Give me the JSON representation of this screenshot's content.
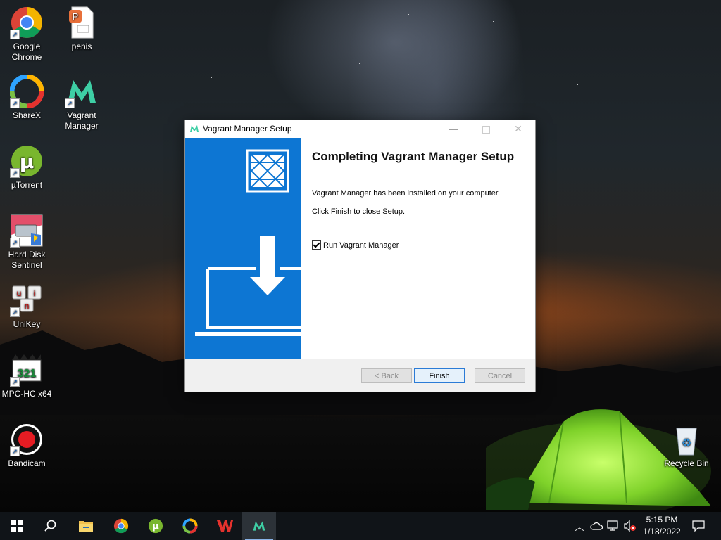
{
  "desktop_icons": [
    {
      "id": "chrome",
      "label_1": "Google",
      "label_2": "Chrome"
    },
    {
      "id": "penis",
      "label_1": "penis",
      "label_2": ""
    },
    {
      "id": "sharex",
      "label_1": "ShareX",
      "label_2": ""
    },
    {
      "id": "vagrant",
      "label_1": "Vagrant",
      "label_2": "Manager"
    },
    {
      "id": "utorrent",
      "label_1": "µTorrent",
      "label_2": ""
    },
    {
      "id": "hds",
      "label_1": "Hard Disk",
      "label_2": "Sentinel"
    },
    {
      "id": "unikey",
      "label_1": "UniKey",
      "label_2": ""
    },
    {
      "id": "mpc",
      "label_1": "MPC-HC x64",
      "label_2": ""
    },
    {
      "id": "bandicam",
      "label_1": "Bandicam",
      "label_2": ""
    },
    {
      "id": "recycle",
      "label_1": "Recycle Bin",
      "label_2": ""
    }
  ],
  "dialog": {
    "title": "Vagrant Manager Setup",
    "heading": "Completing Vagrant Manager Setup",
    "line1": "Vagrant Manager has been installed on your computer.",
    "line2": "Click Finish to close Setup.",
    "checkbox_label": "Run Vagrant Manager",
    "checkbox_checked": true,
    "buttons": {
      "back": "< Back",
      "finish": "Finish",
      "cancel": "Cancel"
    },
    "banner_color": "#0d76d3"
  },
  "taskbar": {
    "items": [
      "windows-start-icon",
      "search-icon",
      "file-explorer-icon",
      "chrome-icon",
      "utorrent-icon",
      "sharex-icon",
      "wps-office-icon",
      "vagrant-manager-icon"
    ],
    "active_item": "vagrant-manager-icon",
    "clock_time": "5:15 PM",
    "clock_date": "1/18/2022"
  }
}
